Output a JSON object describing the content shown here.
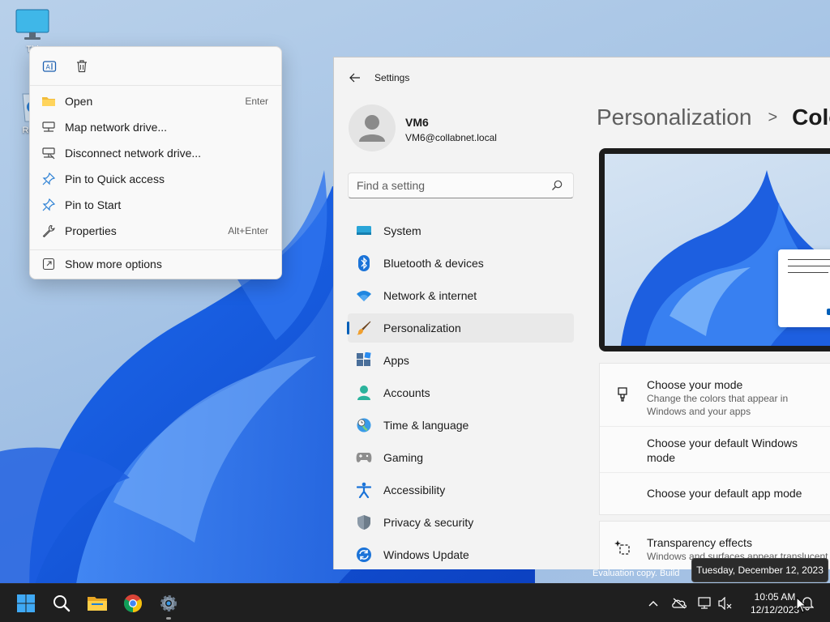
{
  "desktop": {
    "icons": [
      {
        "label": "Thi",
        "icon": "monitor-icon"
      },
      {
        "label": "Recy",
        "icon": "recycle-bin-icon"
      }
    ],
    "watermark": "Evaluation copy. Build"
  },
  "context_menu": {
    "top_actions": [
      {
        "icon": "rename-icon"
      },
      {
        "icon": "delete-icon"
      }
    ],
    "items": [
      {
        "label": "Open",
        "shortcut": "Enter",
        "icon": "folder-icon"
      },
      {
        "label": "Map network drive...",
        "shortcut": "",
        "icon": "map-network-drive-icon"
      },
      {
        "label": "Disconnect network drive...",
        "shortcut": "",
        "icon": "disconnect-network-drive-icon"
      },
      {
        "label": "Pin to Quick access",
        "shortcut": "",
        "icon": "pin-icon"
      },
      {
        "label": "Pin to Start",
        "shortcut": "",
        "icon": "pin-icon"
      },
      {
        "label": "Properties",
        "shortcut": "Alt+Enter",
        "icon": "wrench-icon"
      },
      {
        "label": "Show more options",
        "shortcut": "",
        "icon": "more-options-icon"
      }
    ]
  },
  "settings": {
    "title": "Settings",
    "user": {
      "name": "VM6",
      "email": "VM6@collabnet.local"
    },
    "search_placeholder": "Find a setting",
    "nav": [
      {
        "label": "System",
        "icon": "system-icon",
        "active": false
      },
      {
        "label": "Bluetooth & devices",
        "icon": "bluetooth-icon",
        "active": false
      },
      {
        "label": "Network & internet",
        "icon": "wifi-icon",
        "active": false
      },
      {
        "label": "Personalization",
        "icon": "brush-icon",
        "active": true
      },
      {
        "label": "Apps",
        "icon": "apps-icon",
        "active": false
      },
      {
        "label": "Accounts",
        "icon": "accounts-icon",
        "active": false
      },
      {
        "label": "Time & language",
        "icon": "globe-clock-icon",
        "active": false
      },
      {
        "label": "Gaming",
        "icon": "gamepad-icon",
        "active": false
      },
      {
        "label": "Accessibility",
        "icon": "accessibility-icon",
        "active": false
      },
      {
        "label": "Privacy & security",
        "icon": "shield-icon",
        "active": false
      },
      {
        "label": "Windows Update",
        "icon": "update-icon",
        "active": false
      }
    ],
    "breadcrumb": {
      "parent": "Personalization",
      "separator": ">",
      "current": "Colo"
    },
    "mode_card": [
      {
        "title": "Choose your mode",
        "subtitle": "Change the colors that appear in Windows and your apps"
      },
      {
        "title": "Choose your default Windows mode",
        "subtitle": ""
      },
      {
        "title": "Choose your default app mode",
        "subtitle": ""
      }
    ],
    "transparency": {
      "title": "Transparency effects",
      "subtitle": "Windows and surfaces appear translucent"
    }
  },
  "taskbar": {
    "apps": [
      {
        "icon": "windows-start-icon"
      },
      {
        "icon": "search-icon"
      },
      {
        "icon": "file-explorer-icon"
      },
      {
        "icon": "chrome-icon"
      },
      {
        "icon": "settings-gear-icon"
      }
    ],
    "tray": [
      {
        "icon": "chevron-up-icon"
      },
      {
        "icon": "onedrive-offline-icon"
      },
      {
        "icon": "network-icon"
      },
      {
        "icon": "speaker-muted-icon"
      },
      {
        "icon": "notifications-icon"
      }
    ],
    "time": "10:05 AM",
    "date": "12/12/2023",
    "tooltip": "Tuesday, December 12, 2023"
  },
  "colors": {
    "accent": "#005fb8",
    "taskbar": "#1f1f1f",
    "settings_bg": "#f3f3f3"
  }
}
